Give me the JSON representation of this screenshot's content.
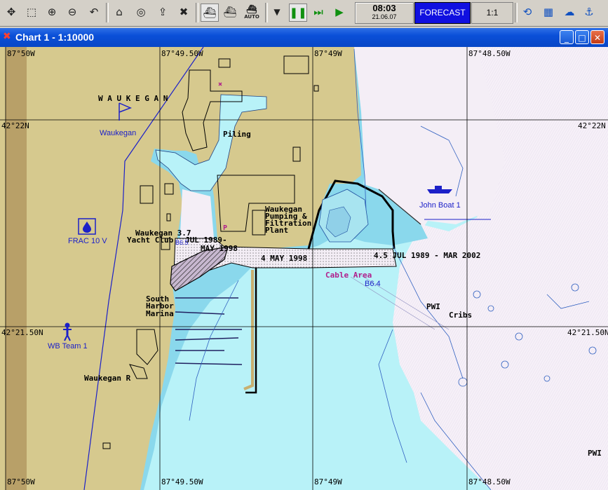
{
  "toolbar": {
    "icons": [
      "pan-icon",
      "zoom-window-icon",
      "zoom-in-icon",
      "zoom-out-icon",
      "undo-icon",
      "route-icon",
      "target-icon",
      "import-icon",
      "erase-icon",
      "ship-up-icon",
      "ship-mode-icon",
      "auto-ship-icon",
      "stop-icon",
      "pause-icon",
      "fast-forward-icon",
      "play-icon"
    ],
    "auto_label": "AUTO",
    "time": "08:03",
    "date": "21.06.07",
    "forecast_label": "FORECAST",
    "scale_label": "1:1"
  },
  "window": {
    "title": "Chart 1 - 1:10000",
    "minimize": "_",
    "maximize": "□",
    "close": "✕"
  },
  "chart": {
    "lon_labels": [
      "87°50W",
      "87°49.50W",
      "87°49W",
      "87°48.50W"
    ],
    "lat_labels": [
      "42°22N",
      "42°21.50N"
    ],
    "place_labels": {
      "town_heading": "W A U K E G A N",
      "waukegan_flag": "Waukegan",
      "piling": "Piling",
      "pumping_1": "Waukegan",
      "pumping_2": "Pumping &",
      "pumping_3": "Filtration",
      "pumping_4": "Plant",
      "yacht_1": "Waukegan 3.7",
      "yacht_2": "Yacht Club",
      "yacht_3": "JUL 1989-",
      "yacht_4": "MAY 1998",
      "depth_may": "4  MAY 1998",
      "depth_jul": "4.5  JUL 1989 - MAR 2002",
      "cable_area": "Cable Area",
      "cable_code": "B6.4",
      "south_1": "South",
      "south_2": "Harbor",
      "south_3": "Marina",
      "pwi": "PWI",
      "cribs": "Cribs",
      "waukegan_r": "Waukegan R",
      "pwi_bottom": "PWI",
      "p_marker": "P",
      "b_marker": "B6.5"
    },
    "targets": {
      "frac": "FRAC 10 V",
      "wb_team": "WB Team 1",
      "john_boat": "John Boat 1"
    },
    "colors": {
      "land": "#d6c98e",
      "shallow": "#8ad8ec",
      "mid": "#b8f2f8",
      "deep": "#f4eef6",
      "grid": "#000000",
      "target": "#1c20c8",
      "magenta": "#b0208c"
    }
  }
}
